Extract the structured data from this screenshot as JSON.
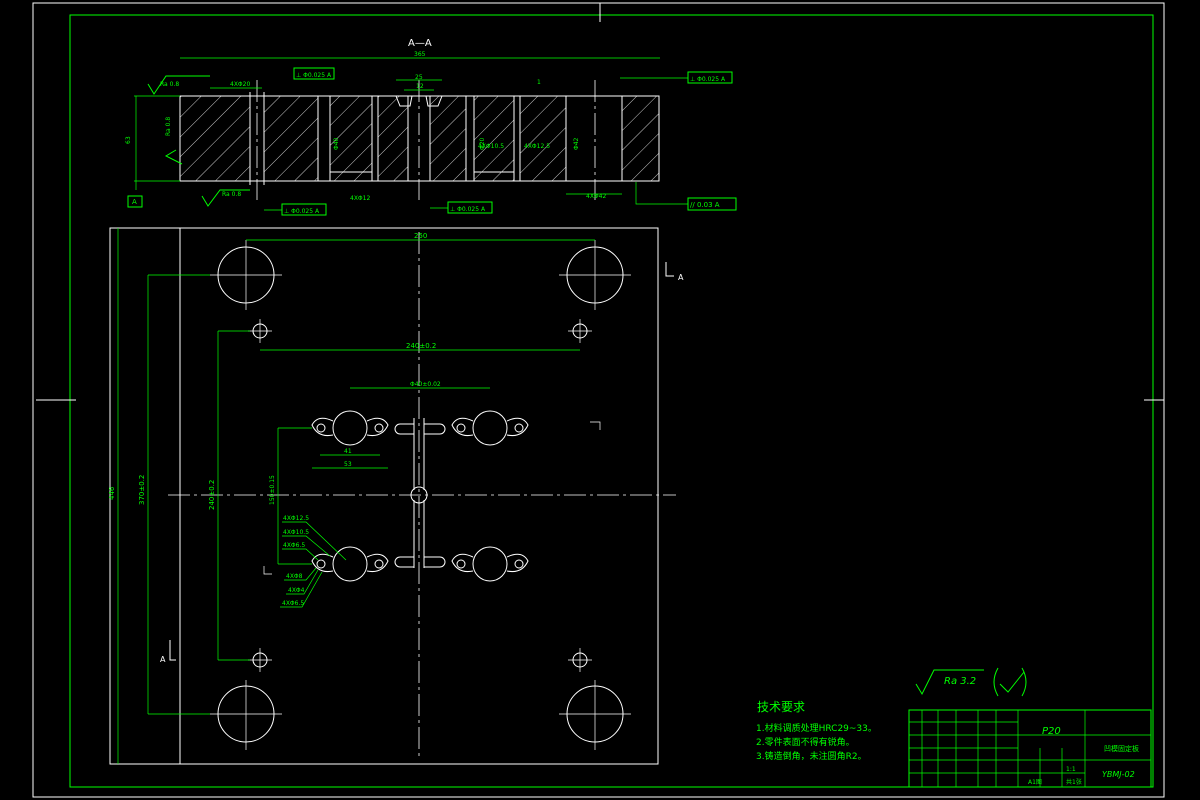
{
  "section": {
    "label": "A—A",
    "overall_width": "365",
    "thickness": "63",
    "dim_25": "25",
    "dim_12": "12",
    "dim_1": "1",
    "holes_4x20": "4XΦ20",
    "holes_4x42": "4XΦ42",
    "hole_4x12": "4XΦ12",
    "hole_4x10_5": "4XΦ10.5",
    "hole_4x12_5": "4XΦ12.5",
    "perp_tol_1": "⊥ Φ0.025 A",
    "perp_tol_2": "⊥ Φ0.025 A",
    "perp_tol_3": "⊥ Φ0.025 A",
    "perp_tol_4": "⊥ Φ0.025 A",
    "parallel_tol": "// 0.03 A",
    "datum": "A",
    "ra_left_top": "Ra 0.8",
    "ra_left_side": "Ra 0.8",
    "ra_left_bottom": "Ra 0.8",
    "dim_40": "Φ40",
    "dim_42": "Φ42",
    "dim_20_vert": "Φ20"
  },
  "plan": {
    "dim_top": "250",
    "dim_pins": "240±0.2",
    "dim_center": "Φ40±0.02",
    "dim_41": "41",
    "dim_53": "53",
    "dim_height": "446",
    "dim_pins_v": "370±0.2",
    "dim_pins_v2": "240±0.2",
    "dim_inner_v": "150±0.15",
    "callouts": [
      "4XΦ12.5",
      "4XΦ10.5",
      "4XΦ6.5",
      "4XΦ8",
      "4XΦ4",
      "4XΦ6.5"
    ],
    "section_mark_right": "A",
    "section_mark_left": "A"
  },
  "requirements": {
    "title": "技术要求",
    "items": [
      "1.材料调质处理HRC29~33。",
      "2.零件表面不得有锐角。",
      "3.铸造倒角，未注圆角R2。"
    ]
  },
  "roughness": {
    "label": "Ra 3.2"
  },
  "title_block": {
    "material": "P20",
    "part_name": "凹模固定板",
    "drawing_no": "YBMJ-02",
    "scale": "1:1",
    "sheet": "A1图",
    "count": "共1张"
  }
}
